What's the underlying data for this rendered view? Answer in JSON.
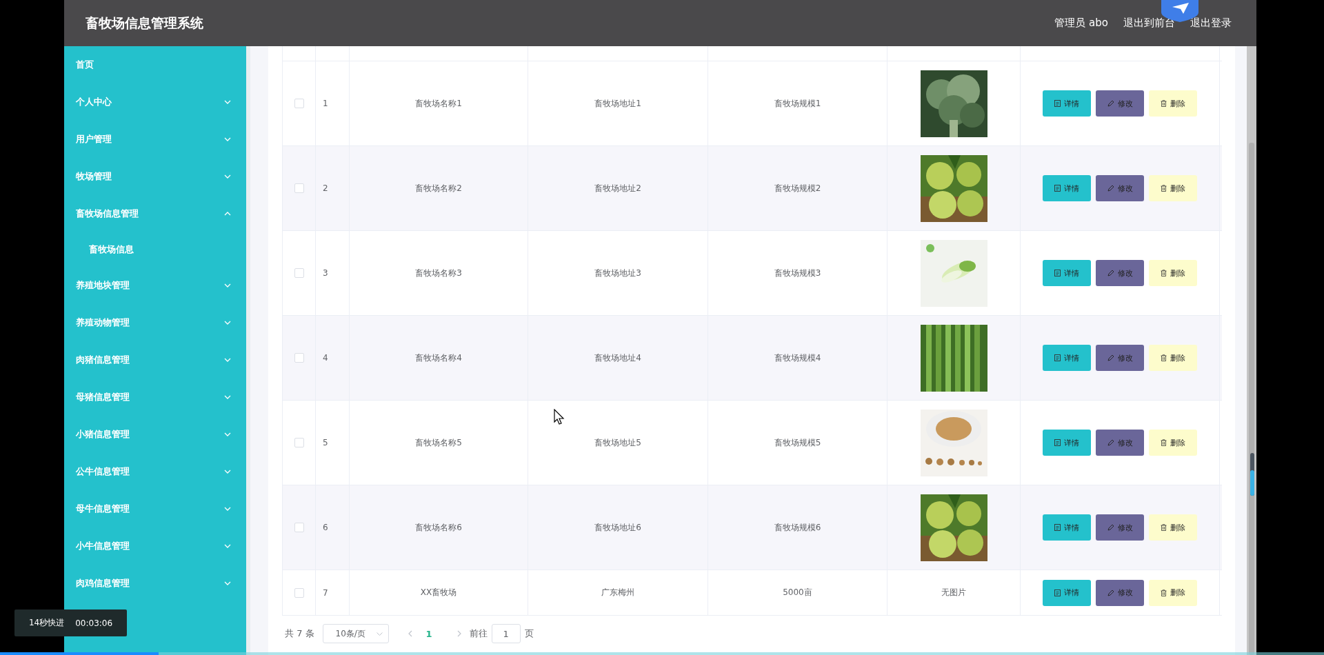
{
  "header": {
    "title": "畜牧场信息管理系统",
    "user": "管理员 abo",
    "links": [
      "退出到前台",
      "退出登录"
    ]
  },
  "sidebar": {
    "items": [
      {
        "label": "首页"
      },
      {
        "label": "个人中心",
        "expanded": false
      },
      {
        "label": "用户管理",
        "expanded": false
      },
      {
        "label": "牧场管理",
        "expanded": false
      },
      {
        "label": "畜牧场信息管理",
        "expanded": true,
        "children": [
          {
            "label": "畜牧场信息"
          }
        ]
      },
      {
        "label": "养殖地块管理",
        "expanded": false
      },
      {
        "label": "养殖动物管理",
        "expanded": false
      },
      {
        "label": "肉猪信息管理",
        "expanded": false
      },
      {
        "label": "母猪信息管理",
        "expanded": false
      },
      {
        "label": "小猪信息管理",
        "expanded": false
      },
      {
        "label": "公牛信息管理",
        "expanded": false
      },
      {
        "label": "母牛信息管理",
        "expanded": false
      },
      {
        "label": "小牛信息管理",
        "expanded": false
      },
      {
        "label": "肉鸡信息管理",
        "expanded": false
      }
    ]
  },
  "table": {
    "rows": [
      {
        "checked": false,
        "index": "1",
        "name": "畜牧场名称1",
        "address": "畜牧场地址1",
        "scale": "畜牧场规模1",
        "actions": [
          {
            "kind": "detail",
            "label": "详情"
          },
          {
            "kind": "edit",
            "label": "修改"
          },
          {
            "kind": "delete",
            "label": "删除"
          }
        ]
      },
      {
        "checked": false,
        "index": "2",
        "name": "畜牧场名称2",
        "address": "畜牧场地址2",
        "scale": "畜牧场规模2",
        "actions": [
          {
            "kind": "detail",
            "label": "详情"
          },
          {
            "kind": "edit",
            "label": "修改"
          },
          {
            "kind": "delete",
            "label": "删除"
          }
        ]
      },
      {
        "checked": false,
        "index": "3",
        "name": "畜牧场名称3",
        "address": "畜牧场地址3",
        "scale": "畜牧场规模3",
        "actions": [
          {
            "kind": "detail",
            "label": "详情"
          },
          {
            "kind": "edit",
            "label": "修改"
          },
          {
            "kind": "delete",
            "label": "删除"
          }
        ]
      },
      {
        "checked": false,
        "index": "4",
        "name": "畜牧场名称4",
        "address": "畜牧场地址4",
        "scale": "畜牧场规模4",
        "actions": [
          {
            "kind": "detail",
            "label": "详情"
          },
          {
            "kind": "edit",
            "label": "修改"
          },
          {
            "kind": "delete",
            "label": "删除"
          }
        ]
      },
      {
        "checked": false,
        "index": "5",
        "name": "畜牧场名称5",
        "address": "畜牧场地址5",
        "scale": "畜牧场规模5",
        "actions": [
          {
            "kind": "detail",
            "label": "详情"
          },
          {
            "kind": "edit",
            "label": "修改"
          },
          {
            "kind": "delete",
            "label": "删除"
          }
        ]
      },
      {
        "checked": false,
        "index": "6",
        "name": "畜牧场名称6",
        "address": "畜牧场地址6",
        "scale": "畜牧场规模6",
        "actions": [
          {
            "kind": "detail",
            "label": "详情"
          },
          {
            "kind": "edit",
            "label": "修改"
          },
          {
            "kind": "delete",
            "label": "删除"
          }
        ]
      },
      {
        "checked": false,
        "index": "7",
        "name": "XX畜牧场",
        "address": "广东梅州",
        "scale": "5000亩",
        "image": {
          "kind": "text",
          "text": "无图片"
        },
        "actions": [
          {
            "kind": "detail",
            "label": "详情"
          },
          {
            "kind": "edit",
            "label": "修改"
          },
          {
            "kind": "delete",
            "label": "删除"
          }
        ]
      }
    ]
  },
  "pagination": {
    "total": "共 7 条",
    "page_size": "10条/页",
    "pages": [
      {
        "label": "1",
        "selected": true
      }
    ],
    "goto_label": "前往",
    "goto_value": "1",
    "goto_suffix": "页"
  },
  "player": {
    "speed_label": "14秒快进",
    "time": "00:03:06",
    "progress": {
      "level": 0.12
    },
    "volume": {
      "level": 0.6
    }
  }
}
